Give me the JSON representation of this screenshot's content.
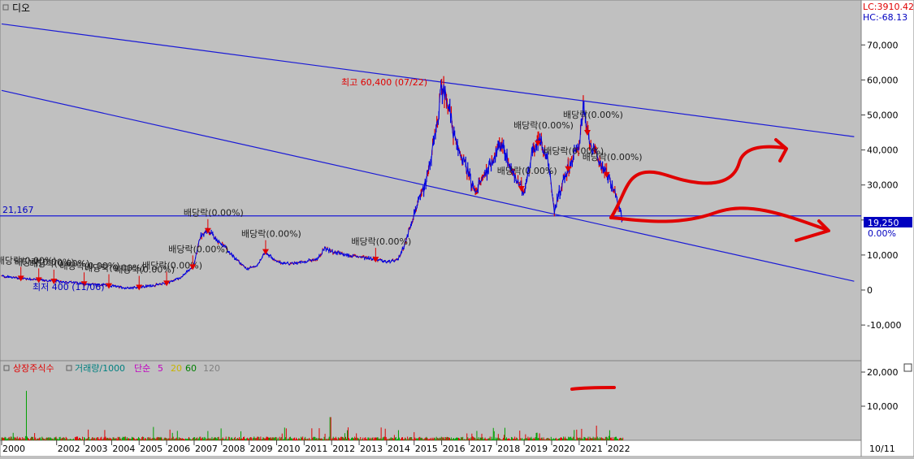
{
  "title": "디오",
  "readouts": {
    "lc": "LC:3910.42",
    "hc": "HC:-68.13"
  },
  "colors": {
    "background": "#c0c0c0",
    "price_up": "#e00000",
    "price_down": "#0000e0",
    "trendline": "#1a1ad6",
    "annotation_red": "#e00000",
    "drawing_red": "#e00000",
    "volume_green": "#00a000",
    "legend_cyan": "#008080",
    "legend_magenta": "#c000c0",
    "legend_yellow": "#c8b400",
    "legend_green": "#008000",
    "legend_gray": "#808080",
    "axis_text": "#000000"
  },
  "chart_data": [
    {
      "type": "line",
      "panel": "price",
      "y_ticks": [
        "70,000",
        "60,000",
        "50,000",
        "40,000",
        "30,000",
        "20,000",
        "10,000",
        "0",
        "-10,000"
      ],
      "ylim": [
        -18000,
        80000
      ],
      "horizontal_line": {
        "label": "21,167",
        "value": 21167
      },
      "current_price_badge": "19,250",
      "current_change": "0.00%",
      "high_label": "최고 60,400 (07/22)",
      "low_label": "최저 400 (11/06)",
      "dividend_label": "배당락(0.00%)",
      "price_series": {
        "x": [
          2000.0,
          2000.5,
          2001.0,
          2001.5,
          2002.0,
          2002.5,
          2003.0,
          2003.5,
          2004.0,
          2004.5,
          2005.0,
          2005.5,
          2006.0,
          2006.5,
          2007.0,
          2007.2,
          2007.5,
          2008.0,
          2008.5,
          2008.9,
          2009.3,
          2009.6,
          2010.0,
          2010.5,
          2011.0,
          2011.5,
          2011.75,
          2012.0,
          2012.5,
          2013.0,
          2013.5,
          2014.0,
          2014.4,
          2014.7,
          2015.0,
          2015.4,
          2015.8,
          2016.0,
          2016.2,
          2016.5,
          2016.9,
          2017.2,
          2017.5,
          2017.9,
          2018.2,
          2018.5,
          2018.8,
          2019.0,
          2019.3,
          2019.6,
          2019.9,
          2020.1,
          2020.2,
          2020.5,
          2020.8,
          2021.0,
          2021.15,
          2021.3,
          2021.5,
          2021.8,
          2022.0,
          2022.3,
          2022.5,
          2022.6
        ],
        "y": [
          4000,
          3500,
          3200,
          2800,
          2500,
          2200,
          1800,
          1500,
          1200,
          600,
          800,
          1300,
          2000,
          3500,
          7000,
          15000,
          17000,
          13000,
          9000,
          6000,
          7000,
          11000,
          8000,
          7500,
          8000,
          9000,
          12000,
          11000,
          10000,
          9500,
          9000,
          8000,
          8500,
          14000,
          22000,
          30000,
          45000,
          58000,
          55000,
          42000,
          35000,
          28000,
          32000,
          38000,
          42000,
          35000,
          30000,
          28000,
          40000,
          43000,
          36000,
          22000,
          26000,
          33000,
          38000,
          42000,
          52000,
          45000,
          40000,
          36000,
          33000,
          28000,
          22000,
          19250
        ]
      },
      "dividend_marker_years": [
        2000.7,
        2001.35,
        2001.9,
        2003.0,
        2003.9,
        2005.0,
        2006.0,
        2006.95,
        2007.5,
        2009.6,
        2013.6,
        2018.9,
        2019.5,
        2020.6,
        2021.3,
        2022.0
      ],
      "trend_lines": [
        {
          "from": [
            2000.0,
            76000
          ],
          "to": [
            2031.0,
            43800
          ]
        },
        {
          "from": [
            2000.0,
            57000
          ],
          "to": [
            2031.0,
            2500
          ]
        }
      ]
    },
    {
      "type": "bar",
      "panel": "volume",
      "legend": [
        "상장주식수",
        "거래량/1000",
        "단순",
        "5",
        "20",
        "60",
        "120"
      ],
      "y_ticks": [
        "20,000",
        "10,000"
      ],
      "ylim": [
        0,
        23000
      ]
    }
  ],
  "x_axis": {
    "year_ticks": [
      "2000",
      "2002",
      "2003",
      "2004",
      "2005",
      "2006",
      "2007",
      "2008",
      "2009",
      "2010",
      "2011",
      "2012",
      "2013",
      "2014",
      "2015",
      "2016",
      "2017",
      "2018",
      "2019",
      "2020",
      "2021",
      "2022"
    ],
    "corner_date": "10/11"
  }
}
